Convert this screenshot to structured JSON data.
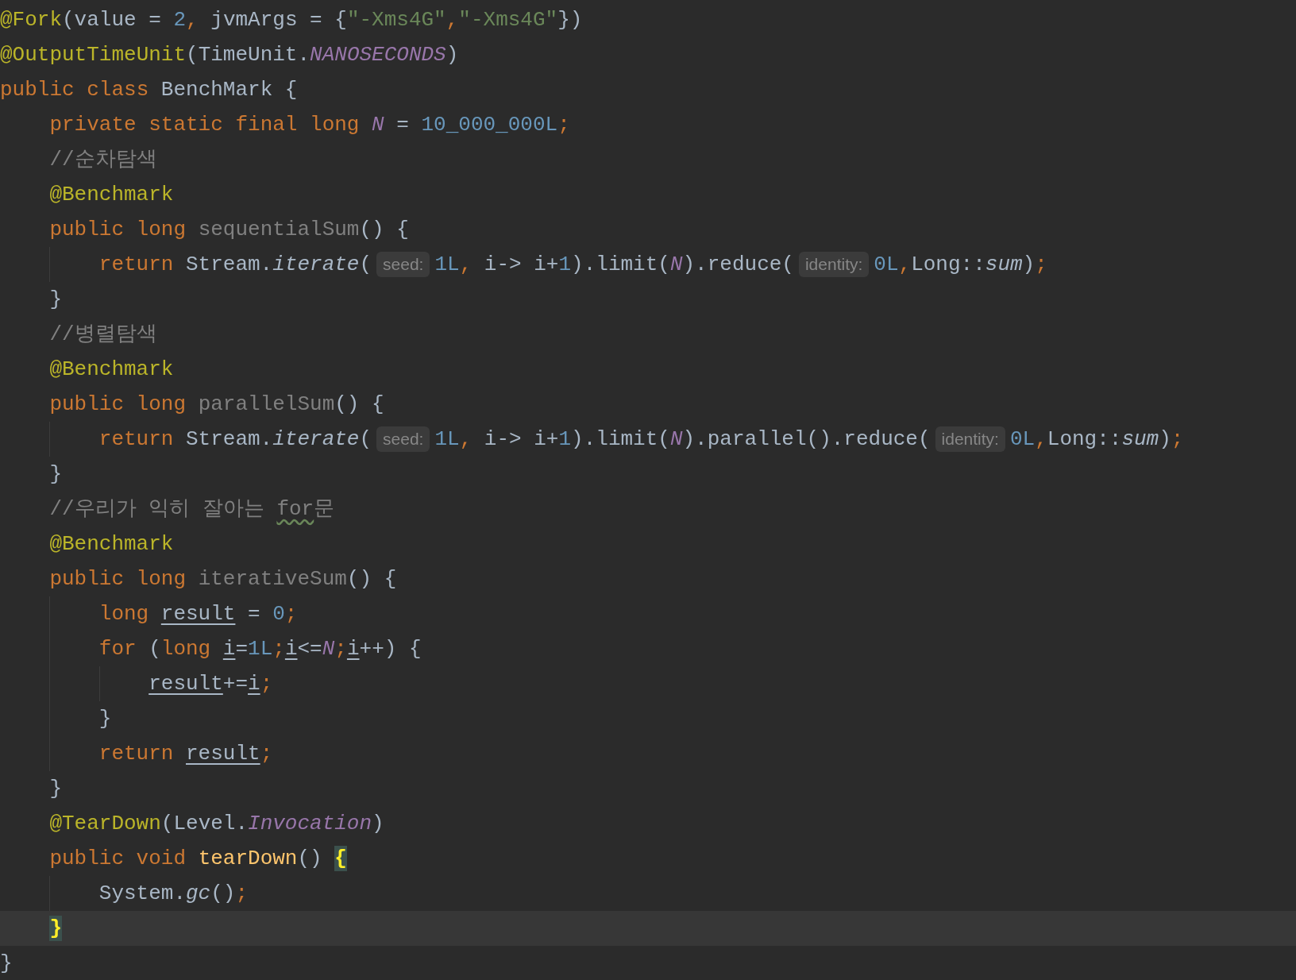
{
  "editor": {
    "lines": [
      {
        "current": false,
        "tokens": [
          {
            "kind": "annotation",
            "text": "@Fork"
          },
          {
            "kind": "plain",
            "text": "(value = "
          },
          {
            "kind": "number",
            "text": "2"
          },
          {
            "kind": "punct",
            "text": ","
          },
          {
            "kind": "plain",
            "text": " jvmArgs = {"
          },
          {
            "kind": "string",
            "text": "\"-Xms4G\""
          },
          {
            "kind": "punct",
            "text": ","
          },
          {
            "kind": "string",
            "text": "\"-Xms4G\""
          },
          {
            "kind": "plain",
            "text": "})"
          }
        ]
      },
      {
        "current": false,
        "tokens": [
          {
            "kind": "annotation",
            "text": "@OutputTimeUnit"
          },
          {
            "kind": "plain",
            "text": "(TimeUnit."
          },
          {
            "kind": "constant",
            "text": "NANOSECONDS"
          },
          {
            "kind": "plain",
            "text": ")"
          }
        ]
      },
      {
        "current": false,
        "tokens": [
          {
            "kind": "keyword",
            "text": "public class "
          },
          {
            "kind": "plain",
            "text": "BenchMark {"
          }
        ],
        "children": [
          {
            "current": false,
            "tokens": [
              {
                "kind": "keyword",
                "text": "private static final long "
              },
              {
                "kind": "constant",
                "text": "N"
              },
              {
                "kind": "plain",
                "text": " = "
              },
              {
                "kind": "number",
                "text": "10_000_000L"
              },
              {
                "kind": "punct",
                "text": ";"
              }
            ]
          },
          {
            "current": false,
            "tokens": [
              {
                "kind": "comment",
                "text": "//순차탐색"
              }
            ]
          },
          {
            "current": false,
            "tokens": [
              {
                "kind": "annotation",
                "text": "@Benchmark"
              }
            ]
          },
          {
            "current": false,
            "tokens": [
              {
                "kind": "keyword",
                "text": "public long "
              },
              {
                "kind": "unused",
                "text": "sequentialSum"
              },
              {
                "kind": "plain",
                "text": "() {"
              }
            ],
            "children": [
              {
                "current": false,
                "tokens": [
                  {
                    "kind": "keyword",
                    "text": "return "
                  },
                  {
                    "kind": "plain",
                    "text": "Stream."
                  },
                  {
                    "kind": "call",
                    "text": "iterate"
                  },
                  {
                    "kind": "plain",
                    "text": "("
                  },
                  {
                    "kind": "hint",
                    "text": "seed:"
                  },
                  {
                    "kind": "number",
                    "text": "1L"
                  },
                  {
                    "kind": "punct",
                    "text": ","
                  },
                  {
                    "kind": "plain",
                    "text": " i-> i+"
                  },
                  {
                    "kind": "number",
                    "text": "1"
                  },
                  {
                    "kind": "plain",
                    "text": ").limit("
                  },
                  {
                    "kind": "constant",
                    "text": "N"
                  },
                  {
                    "kind": "plain",
                    "text": ").reduce("
                  },
                  {
                    "kind": "hint",
                    "text": "identity:"
                  },
                  {
                    "kind": "number",
                    "text": "0L"
                  },
                  {
                    "kind": "punct",
                    "text": ","
                  },
                  {
                    "kind": "plain",
                    "text": "Long::"
                  },
                  {
                    "kind": "call",
                    "text": "sum"
                  },
                  {
                    "kind": "plain",
                    "text": ")"
                  },
                  {
                    "kind": "punct",
                    "text": ";"
                  }
                ]
              }
            ]
          },
          {
            "current": false,
            "tokens": [
              {
                "kind": "plain",
                "text": "}"
              }
            ]
          },
          {
            "current": false,
            "tokens": [
              {
                "kind": "comment",
                "text": "//병렬탐색"
              }
            ]
          },
          {
            "current": false,
            "tokens": [
              {
                "kind": "annotation",
                "text": "@Benchmark"
              }
            ]
          },
          {
            "current": false,
            "tokens": [
              {
                "kind": "keyword",
                "text": "public long "
              },
              {
                "kind": "unused",
                "text": "parallelSum"
              },
              {
                "kind": "plain",
                "text": "() {"
              }
            ],
            "children": [
              {
                "current": false,
                "tokens": [
                  {
                    "kind": "keyword",
                    "text": "return "
                  },
                  {
                    "kind": "plain",
                    "text": "Stream."
                  },
                  {
                    "kind": "call",
                    "text": "iterate"
                  },
                  {
                    "kind": "plain",
                    "text": "("
                  },
                  {
                    "kind": "hint",
                    "text": "seed:"
                  },
                  {
                    "kind": "number",
                    "text": "1L"
                  },
                  {
                    "kind": "punct",
                    "text": ","
                  },
                  {
                    "kind": "plain",
                    "text": " i-> i+"
                  },
                  {
                    "kind": "number",
                    "text": "1"
                  },
                  {
                    "kind": "plain",
                    "text": ").limit("
                  },
                  {
                    "kind": "constant",
                    "text": "N"
                  },
                  {
                    "kind": "plain",
                    "text": ").parallel().reduce("
                  },
                  {
                    "kind": "hint",
                    "text": "identity:"
                  },
                  {
                    "kind": "number",
                    "text": "0L"
                  },
                  {
                    "kind": "punct",
                    "text": ","
                  },
                  {
                    "kind": "plain",
                    "text": "Long::"
                  },
                  {
                    "kind": "call",
                    "text": "sum"
                  },
                  {
                    "kind": "plain",
                    "text": ")"
                  },
                  {
                    "kind": "punct",
                    "text": ";"
                  }
                ]
              }
            ]
          },
          {
            "current": false,
            "tokens": [
              {
                "kind": "plain",
                "text": "}"
              }
            ]
          },
          {
            "current": false,
            "tokens": [
              {
                "kind": "comment",
                "text": "//우리가 익히 잘아는 "
              },
              {
                "kind": "typo",
                "text": "for"
              },
              {
                "kind": "comment",
                "text": "문"
              }
            ]
          },
          {
            "current": false,
            "tokens": [
              {
                "kind": "annotation",
                "text": "@Benchmark"
              }
            ]
          },
          {
            "current": false,
            "tokens": [
              {
                "kind": "keyword",
                "text": "public long "
              },
              {
                "kind": "unused",
                "text": "iterativeSum"
              },
              {
                "kind": "plain",
                "text": "() {"
              }
            ],
            "children": [
              {
                "current": false,
                "tokens": [
                  {
                    "kind": "keyword",
                    "text": "long "
                  },
                  {
                    "kind": "var",
                    "text": "result"
                  },
                  {
                    "kind": "plain",
                    "text": " = "
                  },
                  {
                    "kind": "number",
                    "text": "0"
                  },
                  {
                    "kind": "punct",
                    "text": ";"
                  }
                ]
              },
              {
                "current": false,
                "tokens": [
                  {
                    "kind": "keyword",
                    "text": "for "
                  },
                  {
                    "kind": "plain",
                    "text": "("
                  },
                  {
                    "kind": "keyword",
                    "text": "long "
                  },
                  {
                    "kind": "var",
                    "text": "i"
                  },
                  {
                    "kind": "plain",
                    "text": "="
                  },
                  {
                    "kind": "number",
                    "text": "1L"
                  },
                  {
                    "kind": "punct",
                    "text": ";"
                  },
                  {
                    "kind": "var",
                    "text": "i"
                  },
                  {
                    "kind": "plain",
                    "text": "<="
                  },
                  {
                    "kind": "constant",
                    "text": "N"
                  },
                  {
                    "kind": "punct",
                    "text": ";"
                  },
                  {
                    "kind": "var",
                    "text": "i"
                  },
                  {
                    "kind": "plain",
                    "text": "++) {"
                  }
                ],
                "children": [
                  {
                    "current": false,
                    "tokens": [
                      {
                        "kind": "var",
                        "text": "result"
                      },
                      {
                        "kind": "plain",
                        "text": "+="
                      },
                      {
                        "kind": "var",
                        "text": "i"
                      },
                      {
                        "kind": "punct",
                        "text": ";"
                      }
                    ]
                  }
                ]
              },
              {
                "current": false,
                "tokens": [
                  {
                    "kind": "plain",
                    "text": "}"
                  }
                ]
              },
              {
                "current": false,
                "tokens": [
                  {
                    "kind": "keyword",
                    "text": "return "
                  },
                  {
                    "kind": "var",
                    "text": "result"
                  },
                  {
                    "kind": "punct",
                    "text": ";"
                  }
                ]
              }
            ]
          },
          {
            "current": false,
            "tokens": [
              {
                "kind": "plain",
                "text": "}"
              }
            ]
          },
          {
            "current": false,
            "tokens": [
              {
                "kind": "annotation",
                "text": "@TearDown"
              },
              {
                "kind": "plain",
                "text": "(Level."
              },
              {
                "kind": "constant",
                "text": "Invocation"
              },
              {
                "kind": "plain",
                "text": ")"
              }
            ]
          },
          {
            "current": false,
            "tokens": [
              {
                "kind": "keyword",
                "text": "public void "
              },
              {
                "kind": "method",
                "text": "tearDown"
              },
              {
                "kind": "plain",
                "text": "() "
              },
              {
                "kind": "brace",
                "text": "{"
              }
            ],
            "children": [
              {
                "current": false,
                "tokens": [
                  {
                    "kind": "plain",
                    "text": "System."
                  },
                  {
                    "kind": "call",
                    "text": "gc"
                  },
                  {
                    "kind": "plain",
                    "text": "()"
                  },
                  {
                    "kind": "punct",
                    "text": ";"
                  }
                ]
              }
            ]
          },
          {
            "current": true,
            "tokens": [
              {
                "kind": "brace",
                "text": "}"
              }
            ]
          }
        ]
      },
      {
        "current": false,
        "tokens": [
          {
            "kind": "plain",
            "text": "}"
          }
        ]
      }
    ]
  }
}
